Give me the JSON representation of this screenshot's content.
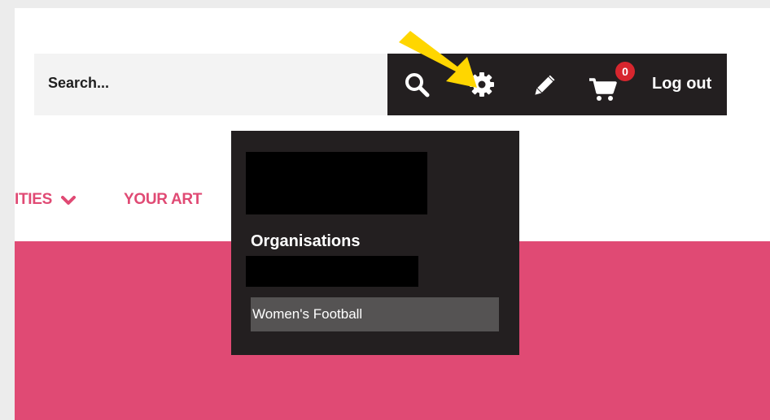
{
  "header": {
    "search": {
      "placeholder": "Search..."
    },
    "toolbar": {
      "icons": [
        "search-icon",
        "gear-icon",
        "pencil-icon",
        "cart-icon"
      ],
      "cart_count": "0",
      "logout_label": "Log out"
    }
  },
  "nav": {
    "items": [
      {
        "label": "ITIES",
        "has_dropdown": true
      },
      {
        "label": "YOUR ART",
        "has_dropdown": false
      }
    ]
  },
  "settings_menu": {
    "organisations_heading": "Organisations",
    "items": [
      {
        "label": "Women's Football"
      }
    ]
  },
  "colors": {
    "accent": "#e04a74",
    "toolbar_bg": "#231f20",
    "badge": "#d7262e",
    "annotation_arrow": "#ffd600"
  }
}
